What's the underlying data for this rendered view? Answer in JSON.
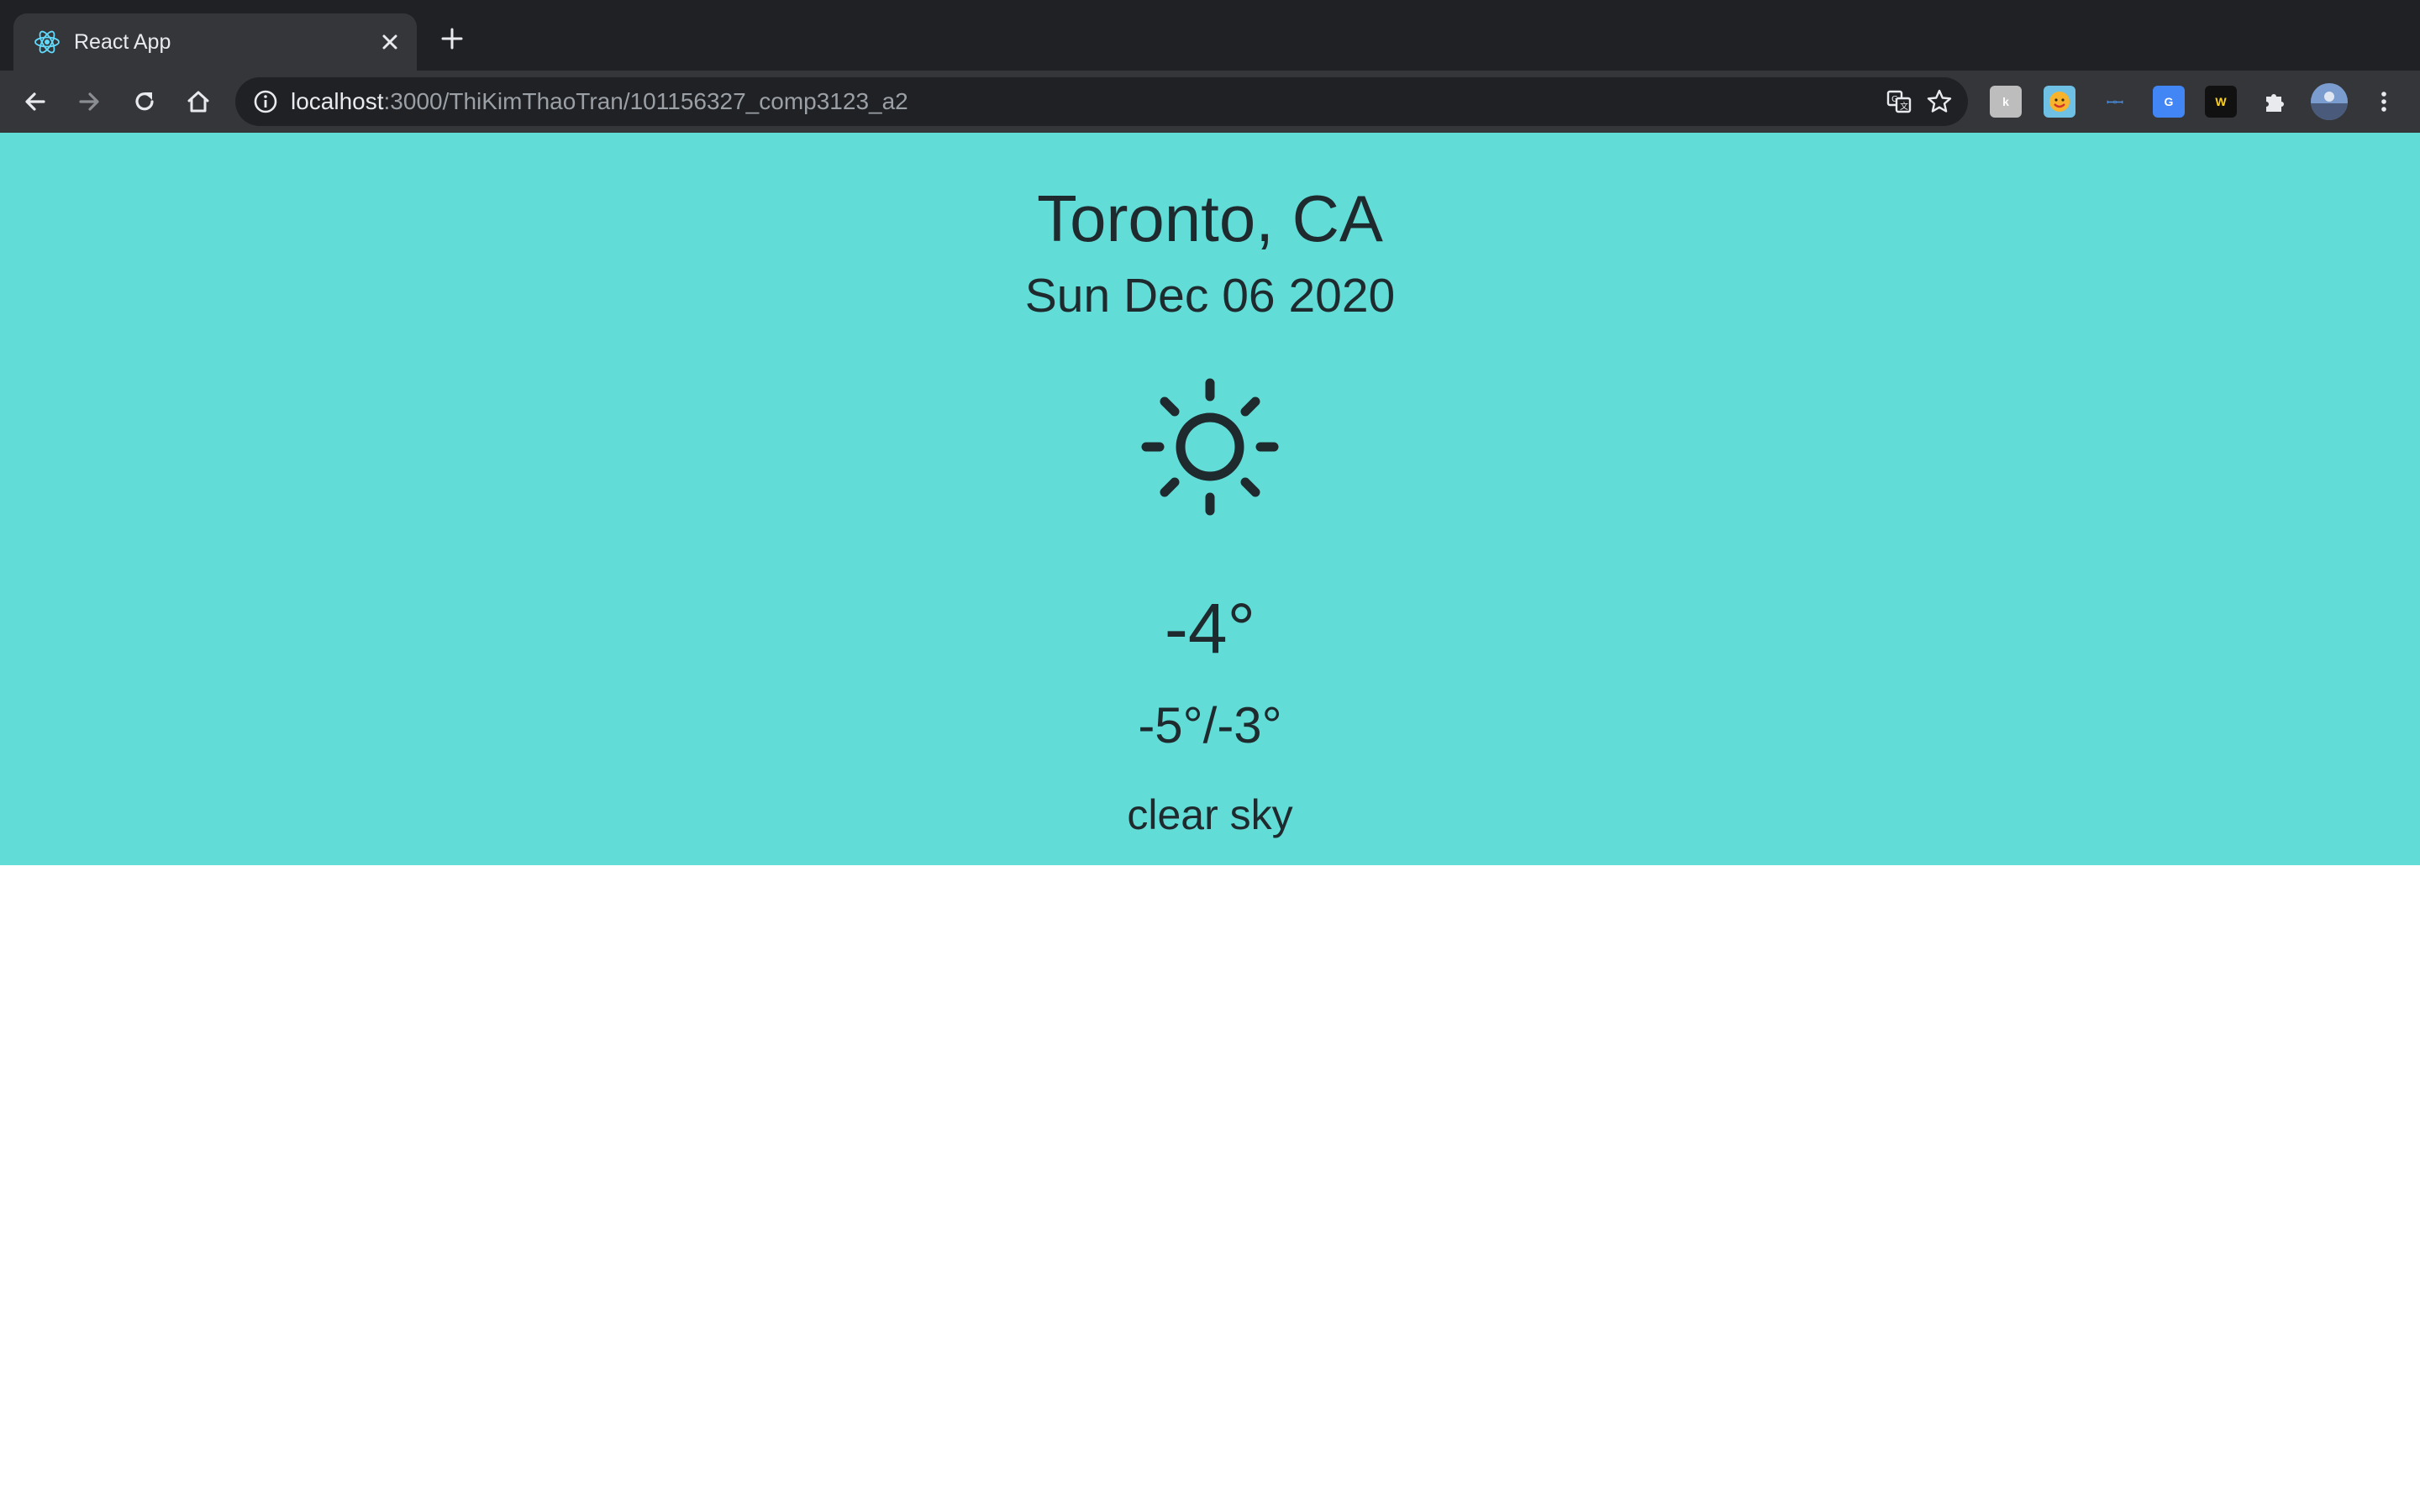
{
  "browser": {
    "tab_title": "React App",
    "url_host": "localhost",
    "url_path": ":3000/ThiKimThaoTran/101156327_comp3123_a2",
    "extensions": [
      "k",
      "",
      "ꟷꟷ",
      "G",
      "W"
    ]
  },
  "weather": {
    "city": "Toronto, CA",
    "date": "Sun Dec 06 2020",
    "icon": "sun-icon",
    "temperature": "-4°",
    "min_max": "-5°/-3°",
    "description": "clear sky"
  },
  "colors": {
    "card_background": "#62dcd6",
    "text": "#1f2a2e",
    "chrome_dark": "#202124",
    "chrome_toolbar": "#35363a"
  }
}
